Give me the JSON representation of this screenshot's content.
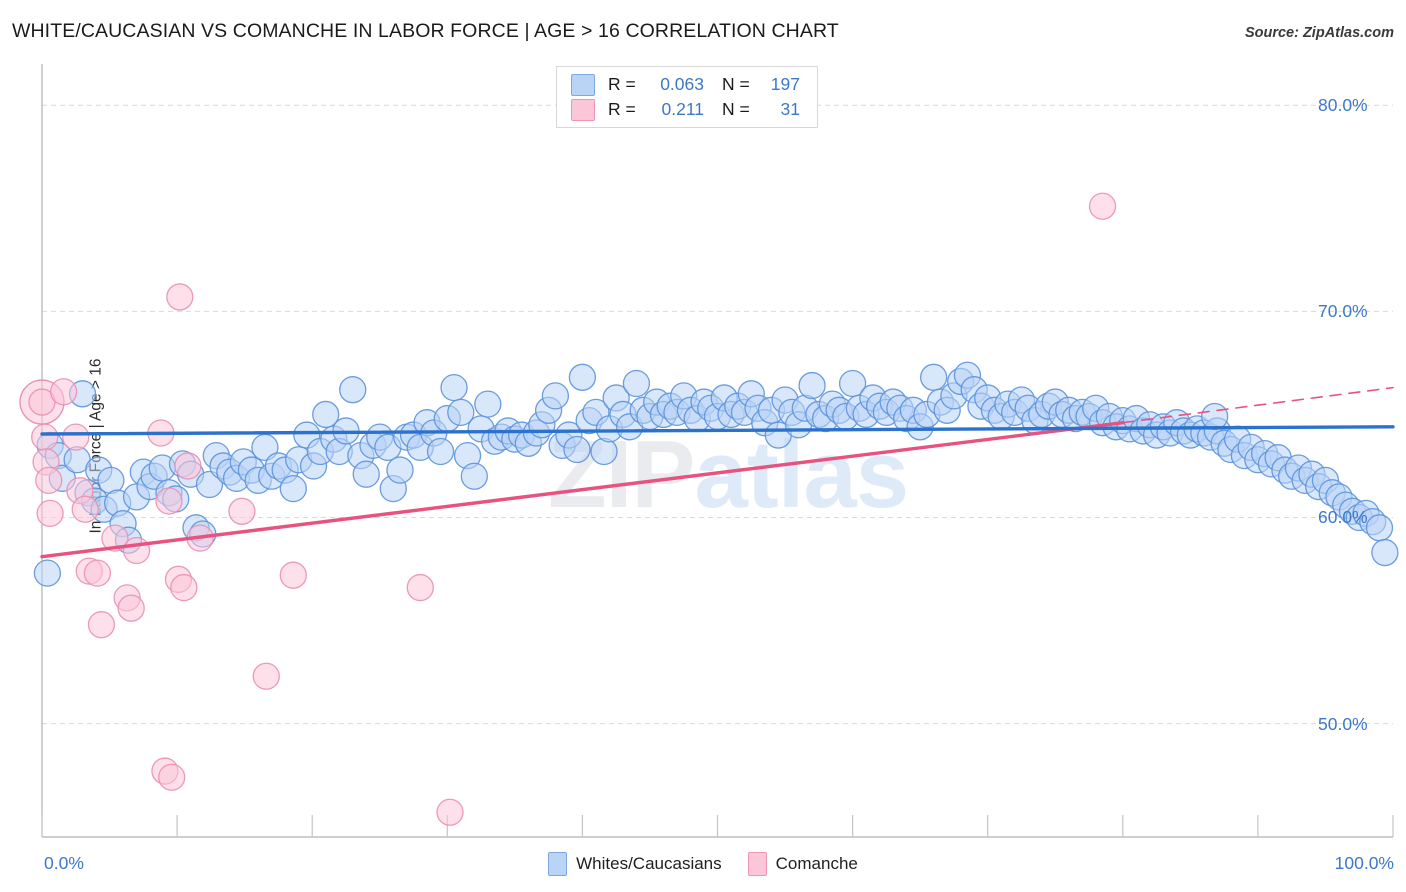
{
  "header": {
    "title": "WHITE/CAUCASIAN VS COMANCHE IN LABOR FORCE | AGE > 16 CORRELATION CHART",
    "source": "Source: ZipAtlas.com"
  },
  "watermark": {
    "part1": "ZIP",
    "part2": "atlas"
  },
  "stats": {
    "rows": [
      {
        "series": "Whites/Caucasians",
        "r_label": "R =",
        "r_value": "0.063",
        "n_label": "N =",
        "n_value": "197",
        "color": "#b9d4f5"
      },
      {
        "series": "Comanche",
        "r_label": "R =",
        "r_value": "0.211",
        "n_label": "N =",
        "n_value": "31",
        "color": "#fbc6d8"
      }
    ]
  },
  "legend": {
    "items": [
      {
        "label": "Whites/Caucasians",
        "color": "#b9d4f5"
      },
      {
        "label": "Comanche",
        "color": "#fbc6d8"
      }
    ]
  },
  "axes": {
    "y_title": "In Labor Force | Age > 16",
    "y_ticks": [
      "80.0%",
      "70.0%",
      "60.0%",
      "50.0%"
    ],
    "x_min": "0.0%",
    "x_max": "100.0%"
  },
  "chart_data": {
    "type": "scatter",
    "title": "WHITE/CAUCASIAN VS COMANCHE IN LABOR FORCE | AGE > 16 CORRELATION CHART",
    "xlabel": "",
    "ylabel": "In Labor Force | Age > 16",
    "xlim": [
      0,
      100
    ],
    "ylim": [
      44.5,
      82.0
    ],
    "xticks": [
      0,
      100
    ],
    "xticklabels": [
      "0.0%",
      "100.0%"
    ],
    "yticks": [
      50,
      60,
      70,
      80
    ],
    "yticklabels": [
      "50.0%",
      "60.0%",
      "70.0%",
      "80.0%"
    ],
    "grid": "horizontal-dashed",
    "legend_position": "bottom-center",
    "series": [
      {
        "name": "Whites/Caucasians",
        "color": "#b9d4f5",
        "edge_color": "#5b92dd",
        "r": 0.063,
        "n": 197,
        "trend": {
          "type": "linear",
          "x0": 0,
          "y0": 64.05,
          "x1": 100,
          "y1": 64.4,
          "style": "solid",
          "color": "#2c72cc"
        },
        "points": [
          [
            0.4,
            57.3
          ],
          [
            0.6,
            63.5
          ],
          [
            1.2,
            63.0
          ],
          [
            1.5,
            61.9
          ],
          [
            2.6,
            62.8
          ],
          [
            3.0,
            66.0
          ],
          [
            3.4,
            61.2
          ],
          [
            3.9,
            60.8
          ],
          [
            4.2,
            62.3
          ],
          [
            4.6,
            60.4
          ],
          [
            5.1,
            61.8
          ],
          [
            5.6,
            60.7
          ],
          [
            6.0,
            59.7
          ],
          [
            6.4,
            58.9
          ],
          [
            7.0,
            61.0
          ],
          [
            7.5,
            62.2
          ],
          [
            8.0,
            61.5
          ],
          [
            8.3,
            62.0
          ],
          [
            8.9,
            62.4
          ],
          [
            9.4,
            61.2
          ],
          [
            9.9,
            60.9
          ],
          [
            10.4,
            62.6
          ],
          [
            11.0,
            62.1
          ],
          [
            11.4,
            59.5
          ],
          [
            11.9,
            59.2
          ],
          [
            12.4,
            61.6
          ],
          [
            12.9,
            63.0
          ],
          [
            13.4,
            62.5
          ],
          [
            13.9,
            62.2
          ],
          [
            14.4,
            61.9
          ],
          [
            14.9,
            62.7
          ],
          [
            15.5,
            62.3
          ],
          [
            16.0,
            61.8
          ],
          [
            16.5,
            63.4
          ],
          [
            17.0,
            62.0
          ],
          [
            17.5,
            62.5
          ],
          [
            18.0,
            62.3
          ],
          [
            18.6,
            61.4
          ],
          [
            19.0,
            62.8
          ],
          [
            19.6,
            64.0
          ],
          [
            20.1,
            62.5
          ],
          [
            20.6,
            63.2
          ],
          [
            21.0,
            65.0
          ],
          [
            21.6,
            63.8
          ],
          [
            22.0,
            63.2
          ],
          [
            22.5,
            64.2
          ],
          [
            23.0,
            66.2
          ],
          [
            23.6,
            63.0
          ],
          [
            24.0,
            62.1
          ],
          [
            24.5,
            63.5
          ],
          [
            25.0,
            63.9
          ],
          [
            25.6,
            63.4
          ],
          [
            26.0,
            61.4
          ],
          [
            26.5,
            62.3
          ],
          [
            27.0,
            63.9
          ],
          [
            27.5,
            64.0
          ],
          [
            28.0,
            63.4
          ],
          [
            28.5,
            64.6
          ],
          [
            29.0,
            64.1
          ],
          [
            29.5,
            63.2
          ],
          [
            30.0,
            64.8
          ],
          [
            30.5,
            66.3
          ],
          [
            31.0,
            65.1
          ],
          [
            31.5,
            63.0
          ],
          [
            32.0,
            62.0
          ],
          [
            32.5,
            64.3
          ],
          [
            33.0,
            65.5
          ],
          [
            33.5,
            63.7
          ],
          [
            34.0,
            63.9
          ],
          [
            34.5,
            64.2
          ],
          [
            35.0,
            63.8
          ],
          [
            35.5,
            64.0
          ],
          [
            36.0,
            63.6
          ],
          [
            36.6,
            64.1
          ],
          [
            37.0,
            64.5
          ],
          [
            37.5,
            65.2
          ],
          [
            38.0,
            65.9
          ],
          [
            38.5,
            63.5
          ],
          [
            39.0,
            64.0
          ],
          [
            39.6,
            63.3
          ],
          [
            40.0,
            66.8
          ],
          [
            40.5,
            64.7
          ],
          [
            41.0,
            65.1
          ],
          [
            41.6,
            63.2
          ],
          [
            42.0,
            64.3
          ],
          [
            42.5,
            65.8
          ],
          [
            43.0,
            65.0
          ],
          [
            43.5,
            64.4
          ],
          [
            44.0,
            66.5
          ],
          [
            44.5,
            65.2
          ],
          [
            45.0,
            64.9
          ],
          [
            45.5,
            65.6
          ],
          [
            46.0,
            65.0
          ],
          [
            46.5,
            65.4
          ],
          [
            47.0,
            65.1
          ],
          [
            47.5,
            65.9
          ],
          [
            48.0,
            65.2
          ],
          [
            48.5,
            64.8
          ],
          [
            49.0,
            65.6
          ],
          [
            49.5,
            65.3
          ],
          [
            50.0,
            64.9
          ],
          [
            50.5,
            65.8
          ],
          [
            51.0,
            65.0
          ],
          [
            51.5,
            65.4
          ],
          [
            52.0,
            65.1
          ],
          [
            52.5,
            66.0
          ],
          [
            53.0,
            65.3
          ],
          [
            53.5,
            64.6
          ],
          [
            54.0,
            65.2
          ],
          [
            54.5,
            64.0
          ],
          [
            55.0,
            65.7
          ],
          [
            55.5,
            65.1
          ],
          [
            56.0,
            64.5
          ],
          [
            56.5,
            65.3
          ],
          [
            57.0,
            66.4
          ],
          [
            57.5,
            65.0
          ],
          [
            58.0,
            64.8
          ],
          [
            58.5,
            65.5
          ],
          [
            59.0,
            65.2
          ],
          [
            59.5,
            64.9
          ],
          [
            60.0,
            66.5
          ],
          [
            60.5,
            65.3
          ],
          [
            61.0,
            65.0
          ],
          [
            61.5,
            65.8
          ],
          [
            62.0,
            65.4
          ],
          [
            62.5,
            65.1
          ],
          [
            63.0,
            65.6
          ],
          [
            63.5,
            65.3
          ],
          [
            64.0,
            64.8
          ],
          [
            64.5,
            65.2
          ],
          [
            65.0,
            64.4
          ],
          [
            65.5,
            65.0
          ],
          [
            66.0,
            66.8
          ],
          [
            66.5,
            65.6
          ],
          [
            67.0,
            65.2
          ],
          [
            67.5,
            65.9
          ],
          [
            68.0,
            66.6
          ],
          [
            68.5,
            66.9
          ],
          [
            69.0,
            66.2
          ],
          [
            69.5,
            65.4
          ],
          [
            70.0,
            65.8
          ],
          [
            70.5,
            65.2
          ],
          [
            71.0,
            64.9
          ],
          [
            71.5,
            65.5
          ],
          [
            72.0,
            65.1
          ],
          [
            72.5,
            65.7
          ],
          [
            73.0,
            65.3
          ],
          [
            73.5,
            64.7
          ],
          [
            74.0,
            65.0
          ],
          [
            74.5,
            65.4
          ],
          [
            75.0,
            65.6
          ],
          [
            75.5,
            65.0
          ],
          [
            76.0,
            65.2
          ],
          [
            76.5,
            64.8
          ],
          [
            77.0,
            65.1
          ],
          [
            77.5,
            64.9
          ],
          [
            78.0,
            65.3
          ],
          [
            78.5,
            64.6
          ],
          [
            79.0,
            64.9
          ],
          [
            79.5,
            64.4
          ],
          [
            80.0,
            64.7
          ],
          [
            80.5,
            64.3
          ],
          [
            81.0,
            64.8
          ],
          [
            81.5,
            64.2
          ],
          [
            82.0,
            64.5
          ],
          [
            82.5,
            64.0
          ],
          [
            83.0,
            64.4
          ],
          [
            83.5,
            64.1
          ],
          [
            84.0,
            64.6
          ],
          [
            84.5,
            64.2
          ],
          [
            85.0,
            64.0
          ],
          [
            85.5,
            64.3
          ],
          [
            86.0,
            64.1
          ],
          [
            86.5,
            63.9
          ],
          [
            87.0,
            64.2
          ],
          [
            87.5,
            63.6
          ],
          [
            88.0,
            63.3
          ],
          [
            88.5,
            63.8
          ],
          [
            89.0,
            63.0
          ],
          [
            89.5,
            63.4
          ],
          [
            90.0,
            62.8
          ],
          [
            90.5,
            63.1
          ],
          [
            91.0,
            62.6
          ],
          [
            91.5,
            62.9
          ],
          [
            92.0,
            62.3
          ],
          [
            92.5,
            62.0
          ],
          [
            93.0,
            62.4
          ],
          [
            93.5,
            61.8
          ],
          [
            94.0,
            62.1
          ],
          [
            94.5,
            61.5
          ],
          [
            95.0,
            61.8
          ],
          [
            95.5,
            61.2
          ],
          [
            96.0,
            61.0
          ],
          [
            96.5,
            60.6
          ],
          [
            97.0,
            60.3
          ],
          [
            97.5,
            60.0
          ],
          [
            98.0,
            60.2
          ],
          [
            98.5,
            59.8
          ],
          [
            99.0,
            59.5
          ],
          [
            99.4,
            58.3
          ],
          [
            86.8,
            64.9
          ]
        ]
      },
      {
        "name": "Comanche",
        "color": "#fbc6d8",
        "edge_color": "#ea8fb2",
        "r": 0.211,
        "n": 31,
        "trend": {
          "type": "linear",
          "x0": 0,
          "y0": 58.1,
          "x1": 80,
          "y1": 64.6,
          "style": "solid",
          "color": "#e8527f"
        },
        "trend_extension": {
          "x0": 80,
          "y0": 64.6,
          "x1": 100,
          "y1": 66.3,
          "style": "dashed",
          "color": "#e8527f"
        },
        "points": [
          [
            0.0,
            65.6
          ],
          [
            0.2,
            63.9
          ],
          [
            0.3,
            62.7
          ],
          [
            0.5,
            61.8
          ],
          [
            0.6,
            60.2
          ],
          [
            1.6,
            66.1
          ],
          [
            2.5,
            63.9
          ],
          [
            2.8,
            61.3
          ],
          [
            3.2,
            60.4
          ],
          [
            3.5,
            57.4
          ],
          [
            4.1,
            57.3
          ],
          [
            4.4,
            54.8
          ],
          [
            5.4,
            59.0
          ],
          [
            6.3,
            56.1
          ],
          [
            6.6,
            55.6
          ],
          [
            7.0,
            58.4
          ],
          [
            8.8,
            64.1
          ],
          [
            9.4,
            60.8
          ],
          [
            10.2,
            70.7
          ],
          [
            10.8,
            62.5
          ],
          [
            10.1,
            57.0
          ],
          [
            10.5,
            56.6
          ],
          [
            9.1,
            47.7
          ],
          [
            9.6,
            47.4
          ],
          [
            11.7,
            59.0
          ],
          [
            14.8,
            60.3
          ],
          [
            16.6,
            52.3
          ],
          [
            18.6,
            57.2
          ],
          [
            28.0,
            56.6
          ],
          [
            30.2,
            45.7
          ],
          [
            78.5,
            75.1
          ]
        ]
      }
    ]
  }
}
